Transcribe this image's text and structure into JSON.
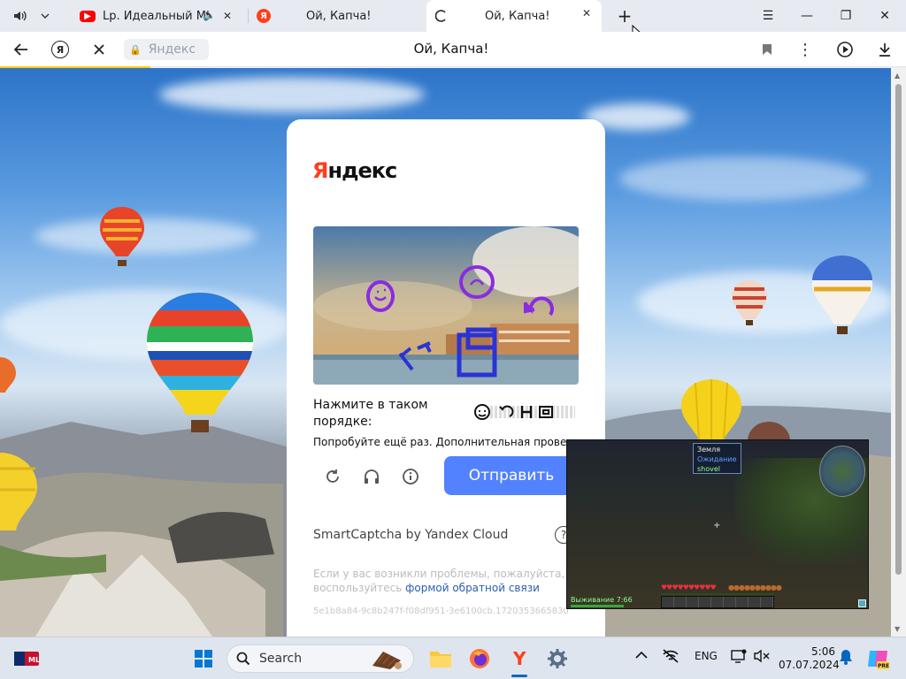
{
  "browser": {
    "tabs": [
      {
        "title": "Lp. Идеальный МИР",
        "favicon": "youtube-icon",
        "muted_icon": "speaker-icon"
      },
      {
        "title": "Ой, Капча!",
        "favicon": "yandex-icon"
      },
      {
        "title": "Ой, Капча!",
        "favicon": "loading-icon",
        "active": true
      }
    ],
    "address": {
      "domain_pill": "Яндекс",
      "page_title": "Ой, Капча!"
    }
  },
  "captcha": {
    "brand_first": "Я",
    "brand_rest": "ндекс",
    "instruction": "Нажмите в таком порядке:",
    "error": "Попробуйте ещё раз. Дополнительная проверка",
    "submit_label": "Отправить",
    "powered_by": "SmartCaptcha by Yandex Cloud",
    "help_symbol": "?",
    "feedback_text": "Если у вас возникли проблемы, пожалуйста, воспользуйтесь",
    "feedback_link": "формой обратной связи",
    "hash": "5e1b8a84-9c8b247f-f08df951-3e6100cb.1720353665830"
  },
  "overlay": {
    "tag_line1": "Земля",
    "tag_line2": "Ожидание",
    "tag_line3": "shovel",
    "status": "Выживание 7:66"
  },
  "taskbar": {
    "search_placeholder": "Search",
    "language": "ENG",
    "time": "5:06",
    "date": "07.07.2024"
  },
  "colors": {
    "accent": "#5282ff",
    "yandex_red": "#fc3f1d",
    "loading_bar": "#ffcc00"
  }
}
